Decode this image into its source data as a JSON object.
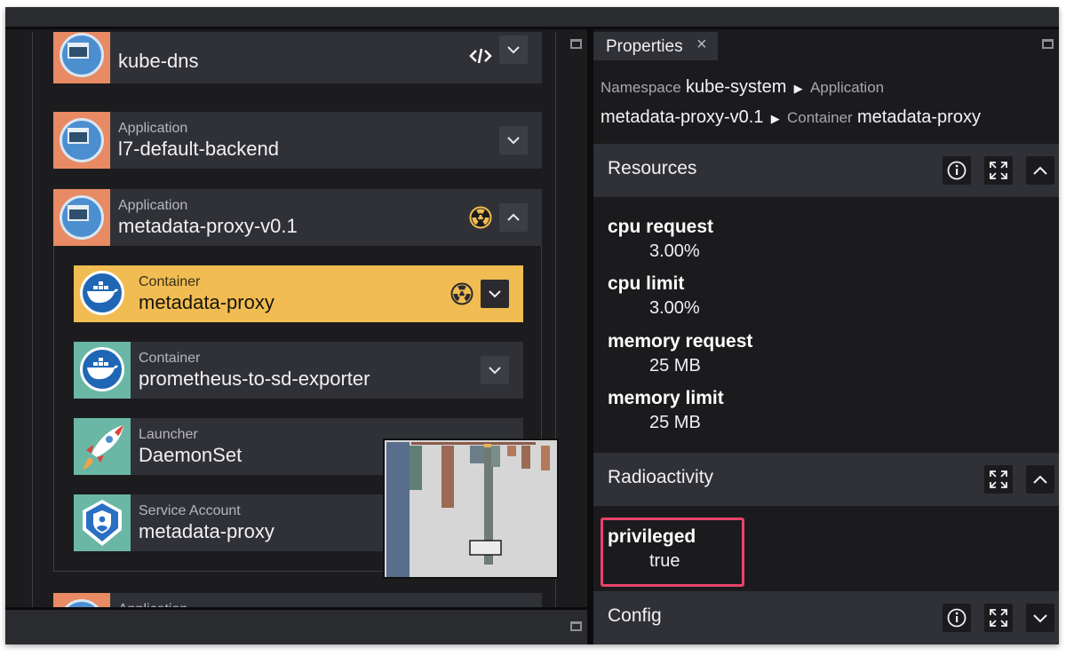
{
  "tree": {
    "items": [
      {
        "type": "",
        "name": "kube-dns"
      },
      {
        "type": "Application",
        "name": "l7-default-backend"
      },
      {
        "type": "Application",
        "name": "metadata-proxy-v0.1"
      },
      {
        "type": "Container",
        "name": "metadata-proxy"
      },
      {
        "type": "Container",
        "name": "prometheus-to-sd-exporter"
      },
      {
        "type": "Launcher",
        "name": "DaemonSet"
      },
      {
        "type": "Service Account",
        "name": "metadata-proxy"
      },
      {
        "type": "Application",
        "name": ""
      }
    ]
  },
  "properties": {
    "tab_label": "Properties",
    "breadcrumb": {
      "namespace_label": "Namespace",
      "namespace_value": "kube-system",
      "application_label": "Application",
      "application_value": "metadata-proxy-v0.1",
      "container_label": "Container",
      "container_value": "metadata-proxy"
    },
    "sections": {
      "resources": {
        "title": "Resources",
        "items": [
          {
            "key": "cpu request",
            "value": "3.00%"
          },
          {
            "key": "cpu limit",
            "value": "3.00%"
          },
          {
            "key": "memory request",
            "value": "25 MB"
          },
          {
            "key": "memory limit",
            "value": "25 MB"
          }
        ]
      },
      "radioactivity": {
        "title": "Radioactivity",
        "items": [
          {
            "key": "privileged",
            "value": "true"
          }
        ]
      },
      "config": {
        "title": "Config"
      }
    }
  },
  "colors": {
    "selected": "#f1bc52",
    "application_icon_bg": "#e88a63",
    "container_icon_bg": "#6bb7a6",
    "radioactive_badge": "#f1bc52",
    "highlight_box": "#e8436b"
  },
  "icons": [
    "application-icon",
    "docker-icon",
    "rocket-icon",
    "service-account-icon",
    "radioactive-icon",
    "chevron-down-icon",
    "chevron-up-icon",
    "info-icon",
    "expand-icon",
    "maximize-icon",
    "close-icon"
  ]
}
